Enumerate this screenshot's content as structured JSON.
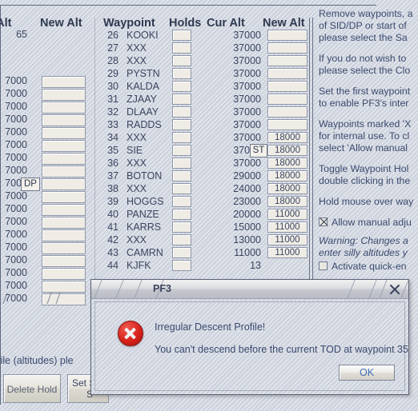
{
  "window": {
    "headers": {
      "cur_alt_left": "r Alt",
      "new_alt_left": "New Alt",
      "waypoint": "Waypoint",
      "holds": "Holds",
      "cur_alt": "Cur Alt",
      "new_alt": "New Alt"
    }
  },
  "left_column": {
    "first_value": "65",
    "values": [
      "7000",
      "7000",
      "7000",
      "7000",
      "7000",
      "7000",
      "7000",
      "7000",
      "7000",
      "7000",
      "7000",
      "7000",
      "7000",
      "7000",
      "7000",
      "7000",
      "7000",
      "7000"
    ],
    "dp_badge": "DP"
  },
  "table": {
    "st_badge": "ST",
    "rows": [
      {
        "idx": "26",
        "name": "KOOKI",
        "cur_alt": "37000",
        "new_alt": ""
      },
      {
        "idx": "27",
        "name": "XXX",
        "cur_alt": "37000",
        "new_alt": ""
      },
      {
        "idx": "28",
        "name": "XXX",
        "cur_alt": "37000",
        "new_alt": ""
      },
      {
        "idx": "29",
        "name": "PYSTN",
        "cur_alt": "37000",
        "new_alt": ""
      },
      {
        "idx": "30",
        "name": "KALDA",
        "cur_alt": "37000",
        "new_alt": ""
      },
      {
        "idx": "31",
        "name": "ZJAAY",
        "cur_alt": "37000",
        "new_alt": ""
      },
      {
        "idx": "32",
        "name": "DLAAY",
        "cur_alt": "37000",
        "new_alt": ""
      },
      {
        "idx": "33",
        "name": "RADDS",
        "cur_alt": "37000",
        "new_alt": ""
      },
      {
        "idx": "34",
        "name": "XXX",
        "cur_alt": "37000",
        "new_alt": "18000"
      },
      {
        "idx": "35",
        "name": "SIE",
        "cur_alt": "37000",
        "new_alt": "18000"
      },
      {
        "idx": "36",
        "name": "XXX",
        "cur_alt": "37000",
        "new_alt": "18000"
      },
      {
        "idx": "37",
        "name": "BOTON",
        "cur_alt": "29000",
        "new_alt": "18000"
      },
      {
        "idx": "38",
        "name": "XXX",
        "cur_alt": "24000",
        "new_alt": "18000"
      },
      {
        "idx": "39",
        "name": "HOGGS",
        "cur_alt": "23000",
        "new_alt": "18000"
      },
      {
        "idx": "40",
        "name": "PANZE",
        "cur_alt": "20000",
        "new_alt": "11000"
      },
      {
        "idx": "41",
        "name": "KARRS",
        "cur_alt": "15000",
        "new_alt": "11000"
      },
      {
        "idx": "42",
        "name": "XXX",
        "cur_alt": "13000",
        "new_alt": "11000"
      },
      {
        "idx": "43",
        "name": "CAMRN",
        "cur_alt": "11000",
        "new_alt": "11000"
      },
      {
        "idx": "44",
        "name": "KJFK",
        "cur_alt": "13",
        "new_alt": ""
      }
    ]
  },
  "help": {
    "p1_line1": "Remove waypoints, a",
    "p1_line2": "of SID/DP or start of",
    "p1_line3": "please select the Sa",
    "p2_line1": "If you do not wish to",
    "p2_line2": "please select the Clo",
    "p3_line1": "Set the first waypoint",
    "p3_line2": "to enable PF3's inter",
    "p4_line1": "Waypoints marked 'X",
    "p4_line2": "for internal use. To cl",
    "p4_line3": "select 'Allow manual",
    "p5_line1": "Toggle Waypoint Hol",
    "p5_line2": "double clicking in the",
    "p6_line1": "Hold mouse over way",
    "checkbox_manual": "Allow manual adju",
    "warn_line1": "Warning: Changes a",
    "warn_line2": "enter silly altitudes y",
    "checkbox_quick": "Activate quick-en"
  },
  "bottom": {
    "note": "rofile (altitudes) ple",
    "delete_hold": "Delete Hold",
    "set_step_line1": "Set S",
    "set_step_line2": "S"
  },
  "dialog": {
    "title": "PF3",
    "heading": "Irregular Descent Profile!",
    "message": "You can't descend before the current TOD at waypoint 35",
    "ok_label": "OK",
    "icon": "error-circle-x"
  },
  "colors": {
    "background": "#d2d7e1",
    "text": "#3b4560",
    "help_text": "#3b4a6e",
    "error_red": "#d8231c",
    "ok_blue": "#3f6fb5"
  }
}
